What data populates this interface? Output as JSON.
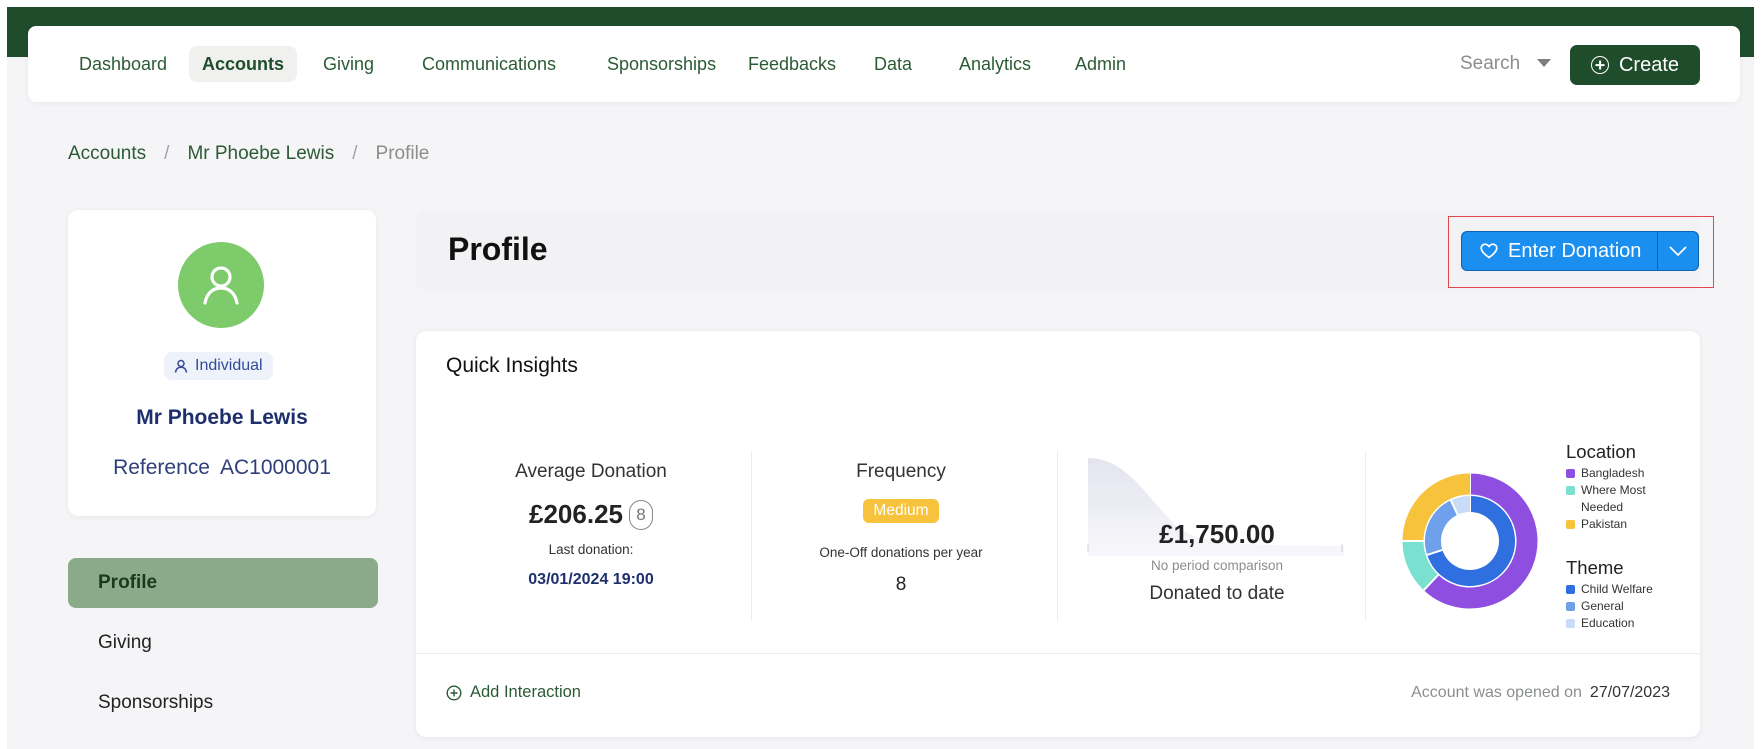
{
  "colors": {
    "brand_green": "#1f4d2b",
    "accent_blue": "#1a8ff0",
    "avatar_green": "#7ecb6b",
    "badge_yellow": "#f7c33d",
    "highlight_red": "#e0484b",
    "sidebar_active": "#8aaa89"
  },
  "nav": {
    "items": [
      {
        "label": "Dashboard",
        "active": false
      },
      {
        "label": "Accounts",
        "active": true
      },
      {
        "label": "Giving",
        "active": false
      },
      {
        "label": "Communications",
        "active": false
      },
      {
        "label": "Sponsorships",
        "active": false
      },
      {
        "label": "Feedbacks",
        "active": false
      },
      {
        "label": "Data",
        "active": false
      },
      {
        "label": "Analytics",
        "active": false
      },
      {
        "label": "Admin",
        "active": false
      }
    ],
    "search_label": "Search",
    "create_label": "Create"
  },
  "breadcrumb": {
    "items": [
      "Accounts",
      "Mr Phoebe Lewis",
      "Profile"
    ],
    "separator": "/"
  },
  "profile_card": {
    "type": "Individual",
    "name": "Mr Phoebe Lewis",
    "reference_label": "Reference",
    "reference_value": "AC1000001"
  },
  "sidebar": {
    "items": [
      {
        "label": "Profile",
        "active": true
      },
      {
        "label": "Giving",
        "active": false
      },
      {
        "label": "Sponsorships",
        "active": false
      }
    ]
  },
  "header": {
    "title": "Profile",
    "donate_label": "Enter Donation"
  },
  "insights": {
    "title": "Quick Insights",
    "average": {
      "label": "Average Donation",
      "value": "£206.25",
      "count": "8",
      "last_label": "Last donation:",
      "last_date": "03/01/2024 19:00"
    },
    "frequency": {
      "label": "Frequency",
      "badge": "Medium",
      "sub_label": "One-Off donations per year",
      "value": "8"
    },
    "donated": {
      "value": "£1,750.00",
      "comparison": "No period comparison",
      "label": "Donated to date"
    },
    "add_interaction": "Add Interaction",
    "opened_label": "Account was opened on",
    "opened_date": "27/07/2023"
  },
  "chart_data": {
    "type": "pie",
    "groups": [
      {
        "name": "Location",
        "slices": [
          {
            "label": "Bangladesh",
            "value": 0.62,
            "color": "#8e4fe0"
          },
          {
            "label": "Where Most Needed",
            "value": 0.13,
            "color": "#7ae0d0"
          },
          {
            "label": "Pakistan",
            "value": 0.25,
            "color": "#f7c33d"
          }
        ]
      },
      {
        "name": "Theme",
        "slices": [
          {
            "label": "Child Welfare",
            "value": 0.7,
            "color": "#2f6fe0"
          },
          {
            "label": "General",
            "value": 0.23,
            "color": "#6fa0ec"
          },
          {
            "label": "Education",
            "value": 0.07,
            "color": "#c8dcf7"
          }
        ]
      }
    ]
  }
}
